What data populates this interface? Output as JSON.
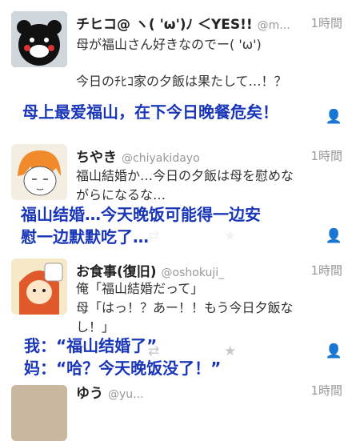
{
  "tweets": [
    {
      "name": "チヒコ@ ヽ( 'ω')ﾉ ＜YES!!",
      "handle": "@m...",
      "time": "1時間",
      "line1": "母が福山さん好きなのでー( 'ω')",
      "line2": "今日のﾁﾋｺ家の夕飯は果たして…！？"
    },
    {
      "name": "ちやき",
      "handle": "@chiyakidayo",
      "time": "1時間",
      "line1": "福山結婚か…今日の夕飯は母を慰めな",
      "line2": "がらになるな…"
    },
    {
      "name": "お食事(復旧)",
      "handle": "@oshokuji_",
      "time": "1時間",
      "line1": "俺「福山結婚だって」",
      "line2": "母「はっ！？あー！！もう今日夕飯な",
      "line3": "し！」"
    },
    {
      "name": "ゆう",
      "handle": "@yu...",
      "time": "1時間"
    }
  ],
  "overlays": {
    "caption1": "母上最爱福山，在下今日晚餐危矣！",
    "caption2_line1": "福山结婚…今天晚饭可能得一边安",
    "caption2_line2": "慰一边默默吃了…",
    "caption3_line1": "我：“福山结婚了”",
    "caption3_line2": "妈：“哈？今天晚饭没了！”"
  },
  "colors": {
    "overlay_text": "#1a36b8",
    "meta_gray": "#999999",
    "divider": "#e4e4e4"
  },
  "icons": [
    "reply-icon",
    "retweet-icon",
    "favorite-icon",
    "follow-icon"
  ]
}
